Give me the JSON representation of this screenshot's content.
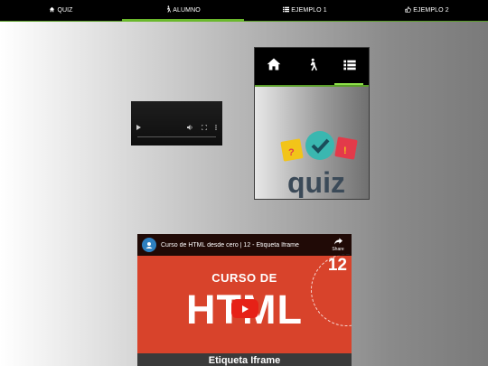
{
  "nav": {
    "items": [
      {
        "label": "QUIZ",
        "icon": "home-icon"
      },
      {
        "label": "ALUMNO",
        "icon": "walking-person-icon"
      },
      {
        "label": "EJEMPLO 1",
        "icon": "list-icon"
      },
      {
        "label": "EJEMPLO 2",
        "icon": "thumbs-up-icon"
      }
    ],
    "active_index": 1
  },
  "mini": {
    "tabs": [
      "home-icon",
      "walking-person-icon",
      "list-icon"
    ],
    "active_index": 2,
    "logo_text": "quiz"
  },
  "youtube": {
    "title": "Curso de HTML desde cero | 12 - Etiqueta Iframe",
    "share_label": "Share",
    "thumb_line1": "CURSO DE",
    "thumb_line2": "HTML",
    "thumb_number": "12",
    "thumb_bottom": "Etiqueta Iframe"
  },
  "colors": {
    "accent": "#6ab82c",
    "nav_bg": "#000000",
    "thumb_bg": "#d8432b"
  }
}
